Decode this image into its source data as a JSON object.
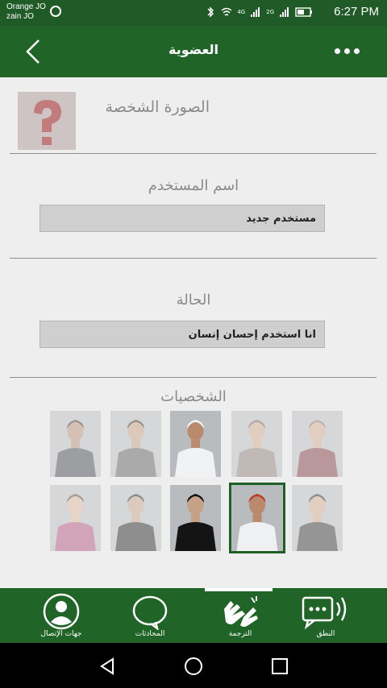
{
  "status_bar": {
    "carrier_1": "Orange JO",
    "carrier_2": "zain JO",
    "time": "6:27 PM",
    "net_1": "4G",
    "net_2": "2G"
  },
  "header": {
    "title": "العضوية"
  },
  "profile": {
    "photo_label": "الصورة الشخصة",
    "username_title": "اسم المستخدم",
    "username_value": "مستخدم جديد",
    "status_title": "الحالة",
    "status_value": "انا استخدم إحسان إنسان",
    "characters_title": "الشخصيات"
  },
  "characters": [
    {
      "name": "man-suit",
      "outfit": "#3a3f47",
      "skin": "#b98a6e",
      "hair": "#3a2a20",
      "dim": true,
      "selected": false
    },
    {
      "name": "man-tshirt",
      "outfit": "#5a5a5a",
      "skin": "#c79b7a",
      "hair": "#2f241c",
      "dim": true,
      "selected": false
    },
    {
      "name": "boy-thobe",
      "outfit": "#f0f2f4",
      "skin": "#b98a6e",
      "hair": "#f5f5f5",
      "dim": false,
      "selected": false
    },
    {
      "name": "woman-hijab",
      "outfit": "#8a7a72",
      "skin": "#d2a88a",
      "hair": "#6b5a55",
      "dim": true,
      "selected": false
    },
    {
      "name": "woman-red-hijab",
      "outfit": "#7d2f35",
      "skin": "#d2a88a",
      "hair": "#8a6f6a",
      "dim": true,
      "selected": false
    },
    {
      "name": "girl-pink",
      "outfit": "#b24b7a",
      "skin": "#e0b89c",
      "hair": "#5a3a2a",
      "dim": true,
      "selected": false
    },
    {
      "name": "woman-black-hijab",
      "outfit": "#1c1c1c",
      "skin": "#c7a088",
      "hair": "#1c1c1c",
      "dim": true,
      "selected": false
    },
    {
      "name": "woman-abaya",
      "outfit": "#141414",
      "skin": "#c7a088",
      "hair": "#141414",
      "dim": false,
      "selected": false
    },
    {
      "name": "man-shemagh",
      "outfit": "#eef0f2",
      "skin": "#b98a6e",
      "hair": "#c0392b",
      "dim": false,
      "selected": true
    },
    {
      "name": "woman-dark",
      "outfit": "#2a2a2a",
      "skin": "#d2a88a",
      "hair": "#1e1e1e",
      "dim": true,
      "selected": false
    }
  ],
  "bottom_nav": [
    {
      "label": "جهات الإتصال",
      "icon": "contacts-icon"
    },
    {
      "label": "المحادثات",
      "icon": "chat-bubble-icon"
    },
    {
      "label": "الترجمة",
      "icon": "sign-language-hand-icon"
    },
    {
      "label": "النطق",
      "icon": "speech-message-icon"
    }
  ],
  "colors": {
    "primary": "#216427",
    "content_bg": "#eeeeee",
    "field_bg": "#cfcfcf"
  }
}
